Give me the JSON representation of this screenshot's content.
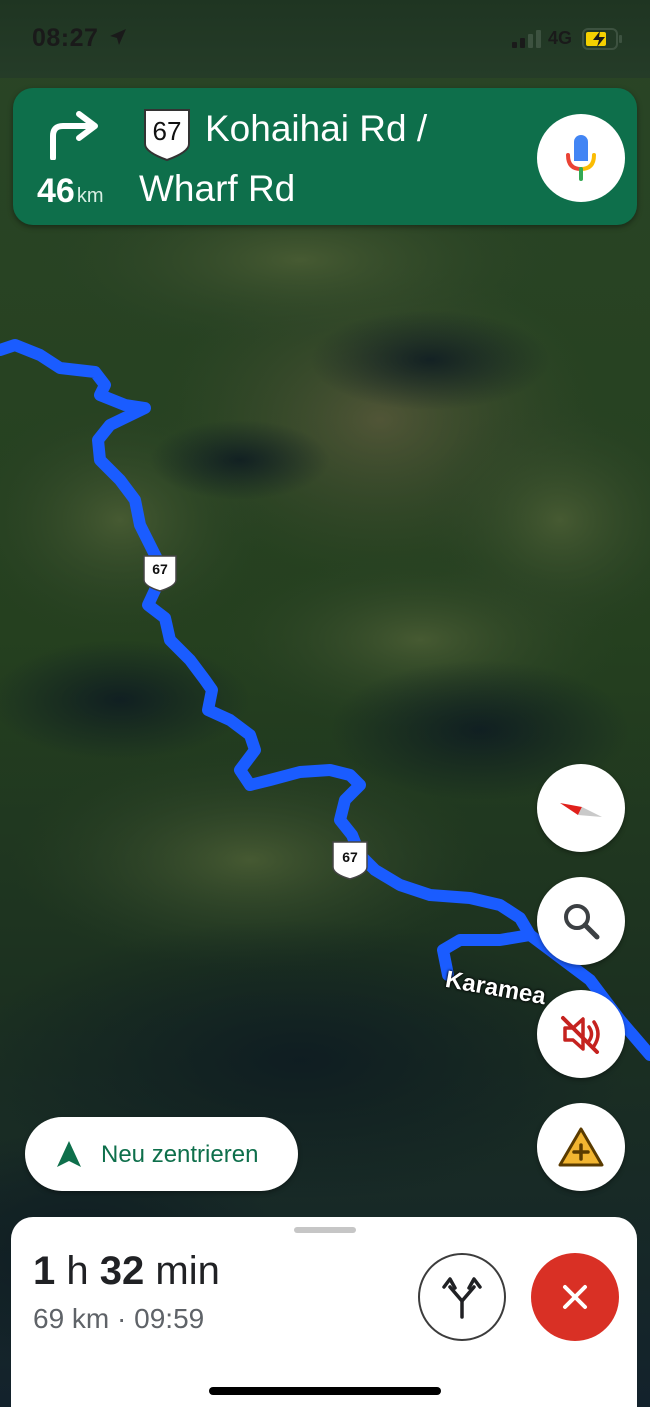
{
  "status_bar": {
    "time": "08:27",
    "network": "4G",
    "location_icon": "location-arrow-icon",
    "battery_icon": "battery-charging-icon"
  },
  "navigation": {
    "maneuver_icon": "turn-right-arrow-icon",
    "distance_value": "46",
    "distance_unit": "km",
    "route_shield": "67",
    "street_line1": "Kohaihai Rd /",
    "street_line2": "Wharf Rd",
    "voice_icon": "microphone-icon"
  },
  "map": {
    "road_shields": [
      "67",
      "67"
    ],
    "road_label": "Karamea",
    "route_color": "#1a5cff"
  },
  "controls": {
    "compass_icon": "compass-icon",
    "search_icon": "search-icon",
    "mute_icon": "sound-muted-icon",
    "report_icon": "report-incident-icon"
  },
  "recenter": {
    "label": "Neu zentrieren",
    "icon": "navigation-arrow-icon"
  },
  "trip": {
    "hours": "1",
    "hours_unit": "h",
    "minutes": "32",
    "minutes_unit": "min",
    "distance": "69 km",
    "separator": "·",
    "arrival_time": "09:59",
    "route_options_icon": "alternate-routes-icon",
    "close_icon": "close-icon"
  },
  "colors": {
    "banner": "#0e6f4b",
    "accent_green": "#0e6f4b",
    "close_red": "#d93025",
    "warning_yellow": "#f2b531"
  }
}
